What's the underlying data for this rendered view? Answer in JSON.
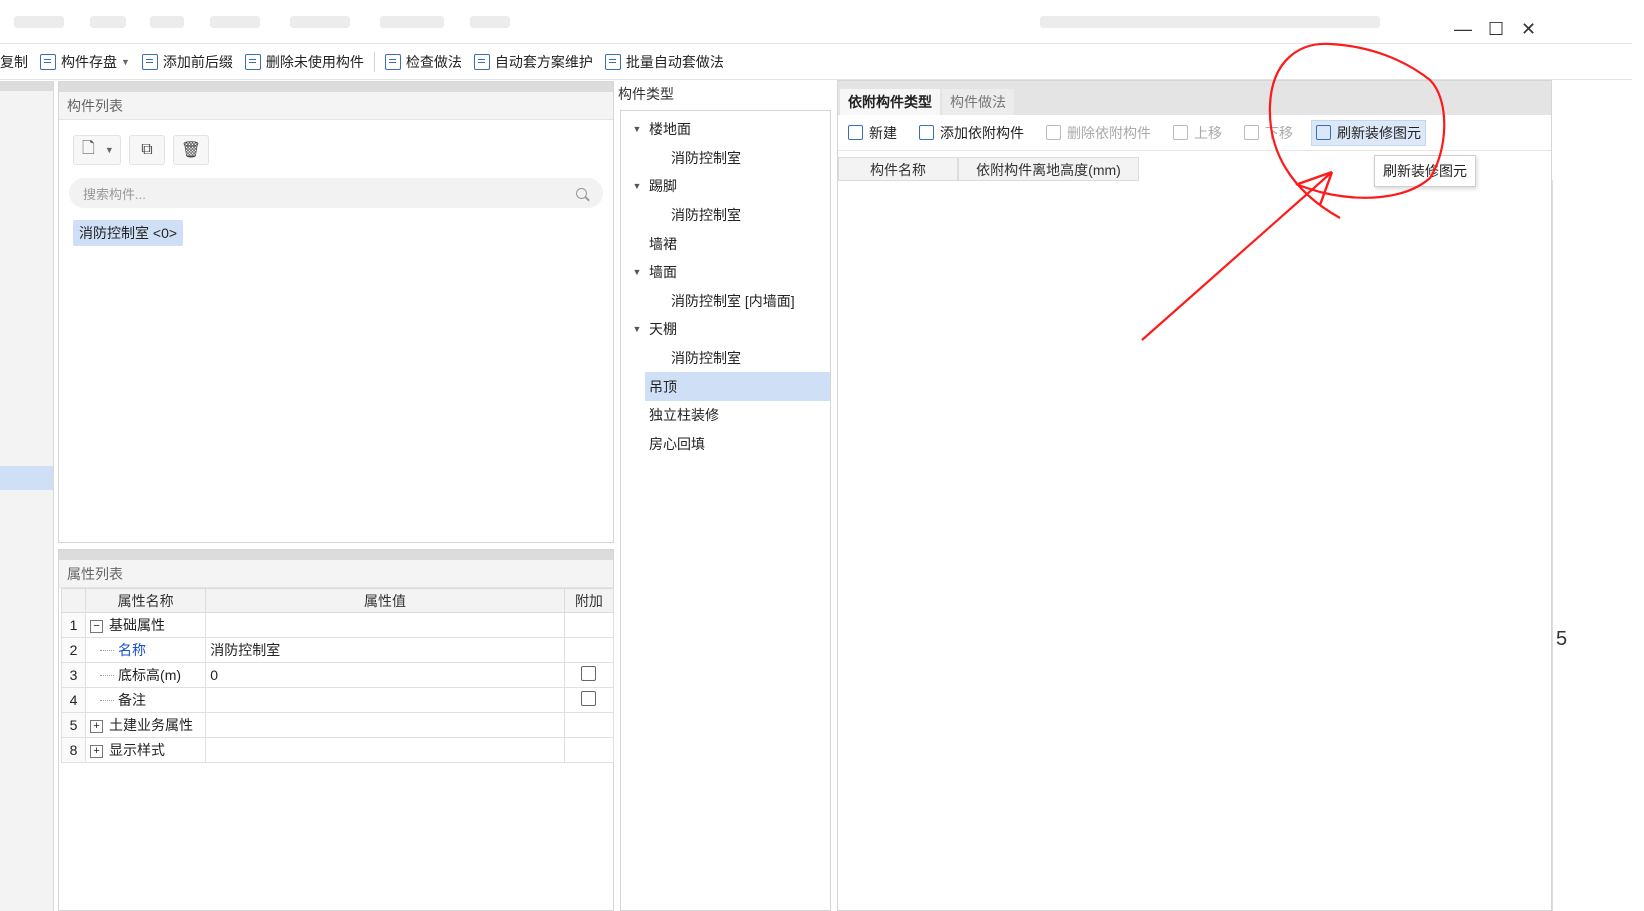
{
  "toolbar": {
    "items": [
      {
        "label": "复制",
        "has_caret": false
      },
      {
        "label": "构件存盘",
        "has_caret": true
      },
      {
        "label": "添加前后缀",
        "has_caret": false
      },
      {
        "label": "删除未使用构件",
        "has_caret": false
      },
      {
        "label": "检查做法",
        "has_caret": false
      },
      {
        "label": "自动套方案维护",
        "has_caret": false
      },
      {
        "label": "批量自动套做法",
        "has_caret": false
      }
    ]
  },
  "window_controls": {
    "minimize": "—",
    "maximize": "☐",
    "close": "✕"
  },
  "component_list": {
    "title": "构件列表",
    "search_placeholder": "搜索构件...",
    "items": [
      "消防控制室 <0>"
    ]
  },
  "property_list": {
    "title": "属性列表",
    "columns": [
      "属性名称",
      "属性值",
      "附加"
    ],
    "rows": [
      {
        "num": "1",
        "name": "基础属性",
        "value": "",
        "toggle": "−",
        "child": false,
        "checkbox": false,
        "blue": false
      },
      {
        "num": "2",
        "name": "名称",
        "value": "消防控制室",
        "toggle": "",
        "child": true,
        "checkbox": false,
        "blue": true
      },
      {
        "num": "3",
        "name": "底标高(m)",
        "value": "0",
        "toggle": "",
        "child": true,
        "checkbox": true,
        "blue": false
      },
      {
        "num": "4",
        "name": "备注",
        "value": "",
        "toggle": "",
        "child": true,
        "checkbox": true,
        "blue": false
      },
      {
        "num": "5",
        "name": "土建业务属性",
        "value": "",
        "toggle": "+",
        "child": false,
        "checkbox": false,
        "blue": false
      },
      {
        "num": "8",
        "name": "显示样式",
        "value": "",
        "toggle": "+",
        "child": false,
        "checkbox": false,
        "blue": false
      }
    ]
  },
  "component_types": {
    "title": "构件类型",
    "nodes": [
      {
        "label": "楼地面",
        "kind": "parent"
      },
      {
        "label": "消防控制室",
        "kind": "child"
      },
      {
        "label": "踢脚",
        "kind": "parent"
      },
      {
        "label": "消防控制室",
        "kind": "child"
      },
      {
        "label": "墙裙",
        "kind": "leaf"
      },
      {
        "label": "墙面",
        "kind": "parent"
      },
      {
        "label": "消防控制室 [内墙面]",
        "kind": "child"
      },
      {
        "label": "天棚",
        "kind": "parent"
      },
      {
        "label": "消防控制室",
        "kind": "child"
      },
      {
        "label": "吊顶",
        "kind": "selected"
      },
      {
        "label": "独立柱装修",
        "kind": "leaf"
      },
      {
        "label": "房心回填",
        "kind": "leaf"
      }
    ]
  },
  "right_panel": {
    "tabs": [
      "依附构件类型",
      "构件做法"
    ],
    "tools": [
      {
        "label": "新建",
        "disabled": false,
        "highlight": false
      },
      {
        "label": "添加依附构件",
        "disabled": false,
        "highlight": false
      },
      {
        "label": "删除依附构件",
        "disabled": true,
        "highlight": false
      },
      {
        "label": "上移",
        "disabled": true,
        "highlight": false
      },
      {
        "label": "下移",
        "disabled": true,
        "highlight": false
      },
      {
        "label": "刷新装修图元",
        "disabled": false,
        "highlight": true
      }
    ],
    "columns": [
      "构件名称",
      "依附构件离地高度(mm)"
    ],
    "tooltip": "刷新装修图元"
  },
  "far_right": {
    "partial_text": "5"
  },
  "annotation_color": "#ff1a1a"
}
